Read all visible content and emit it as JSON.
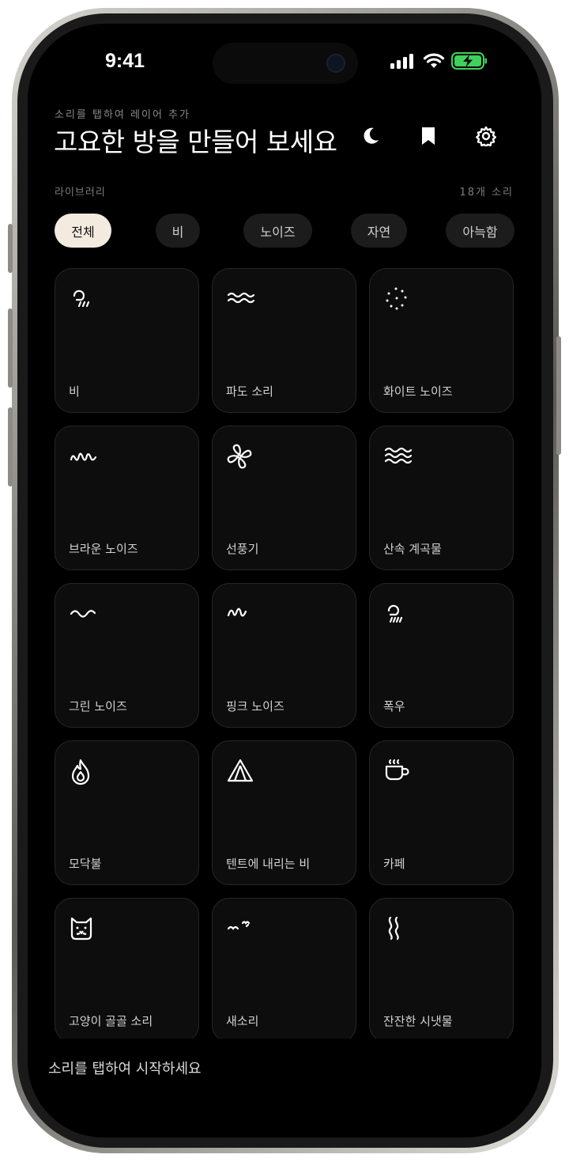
{
  "status_bar": {
    "time": "9:41"
  },
  "header": {
    "subtitle": "소리를 탭하여 레이어 추가",
    "title": "고요한 방을 만들어 보세요"
  },
  "library": {
    "label": "라이브러리",
    "count": "18개 소리"
  },
  "chips": [
    "전체",
    "비",
    "노이즈",
    "자연",
    "아늑함"
  ],
  "sounds": [
    {
      "label": "비",
      "icon": "rain-cloud-icon"
    },
    {
      "label": "파도 소리",
      "icon": "waves-icon"
    },
    {
      "label": "화이트 노이즈",
      "icon": "dots-circle-icon"
    },
    {
      "label": "브라운 노이즈",
      "icon": "squiggle-icon"
    },
    {
      "label": "선풍기",
      "icon": "fan-icon"
    },
    {
      "label": "산속 계곡물",
      "icon": "stream-icon"
    },
    {
      "label": "그린 노이즈",
      "icon": "wave-line-icon"
    },
    {
      "label": "핑크 노이즈",
      "icon": "zigzag-icon"
    },
    {
      "label": "폭우",
      "icon": "heavy-rain-icon"
    },
    {
      "label": "모닥불",
      "icon": "flame-icon"
    },
    {
      "label": "텐트에 내리는 비",
      "icon": "tent-icon"
    },
    {
      "label": "카페",
      "icon": "coffee-cup-icon"
    },
    {
      "label": "고양이 골골 소리",
      "icon": "cat-icon"
    },
    {
      "label": "새소리",
      "icon": "bird-icon"
    },
    {
      "label": "잔잔한 시냇물",
      "icon": "steam-icon"
    }
  ],
  "bottom": {
    "hint": "소리를 탭하여 시작하세요"
  },
  "colors": {
    "accent_chip": "#f3ebdf",
    "tile_bg": "#0d0d0d",
    "battery_green": "#3fd15b"
  }
}
